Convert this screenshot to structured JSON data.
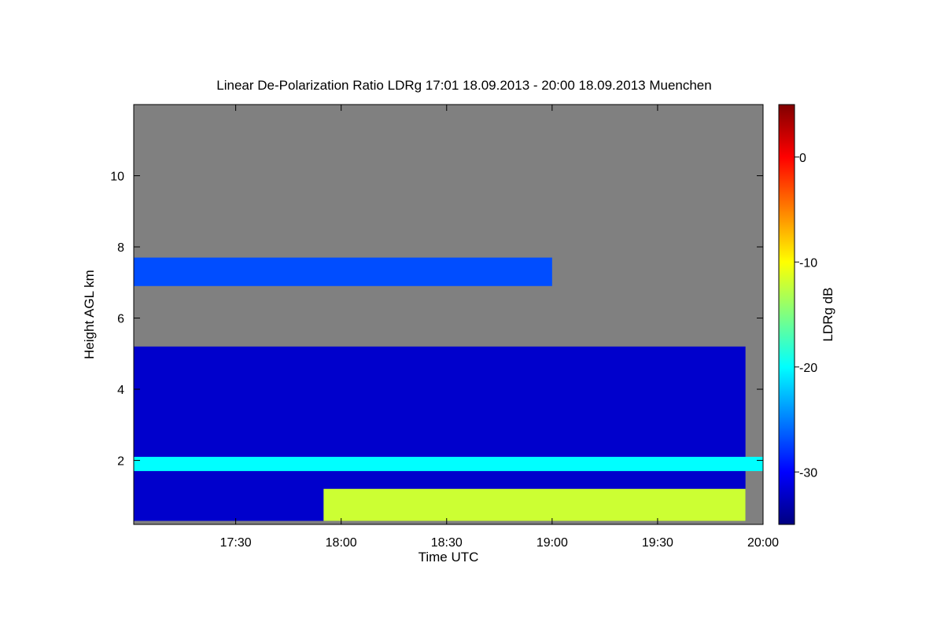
{
  "chart_data": {
    "type": "heatmap",
    "title": "Linear De-Polarization Ratio LDRg   17:01 18.09.2013 - 20:00 18.09.2013 Muenchen",
    "xlabel": "Time UTC",
    "ylabel": "Height AGL km",
    "colorbar_label": "LDRg dB",
    "x_range": [
      "17:01",
      "20:00"
    ],
    "x_ticks": [
      "17:30",
      "18:00",
      "18:30",
      "19:00",
      "19:30",
      "20:00"
    ],
    "ylim": [
      0.2,
      12.0
    ],
    "y_ticks": [
      2,
      4,
      6,
      8,
      10
    ],
    "colorbar_range": [
      -35,
      5
    ],
    "colorbar_ticks": [
      0,
      -10,
      -20,
      -30
    ],
    "colormap": [
      "#000080",
      "#0000ff",
      "#0080ff",
      "#00ffff",
      "#80ff80",
      "#ffff00",
      "#ff8000",
      "#ff0000",
      "#800000"
    ],
    "no_signal_color": "#808080",
    "features": [
      {
        "name": "upper cloud layer",
        "time": [
          "17:01",
          "19:00"
        ],
        "height_km": [
          6.9,
          7.7
        ],
        "ldr_db": -27
      },
      {
        "name": "lower cloud body",
        "time": [
          "17:01",
          "19:55"
        ],
        "height_km": [
          0.3,
          5.2
        ],
        "ldr_db": -32
      },
      {
        "name": "bright band",
        "time": [
          "17:01",
          "20:00"
        ],
        "height_km": [
          1.7,
          2.1
        ],
        "ldr_db": -20
      },
      {
        "name": "depolarizing particles near ground",
        "time": [
          "17:55",
          "19:55"
        ],
        "height_km": [
          0.3,
          1.2
        ],
        "ldr_db": -12
      }
    ]
  }
}
